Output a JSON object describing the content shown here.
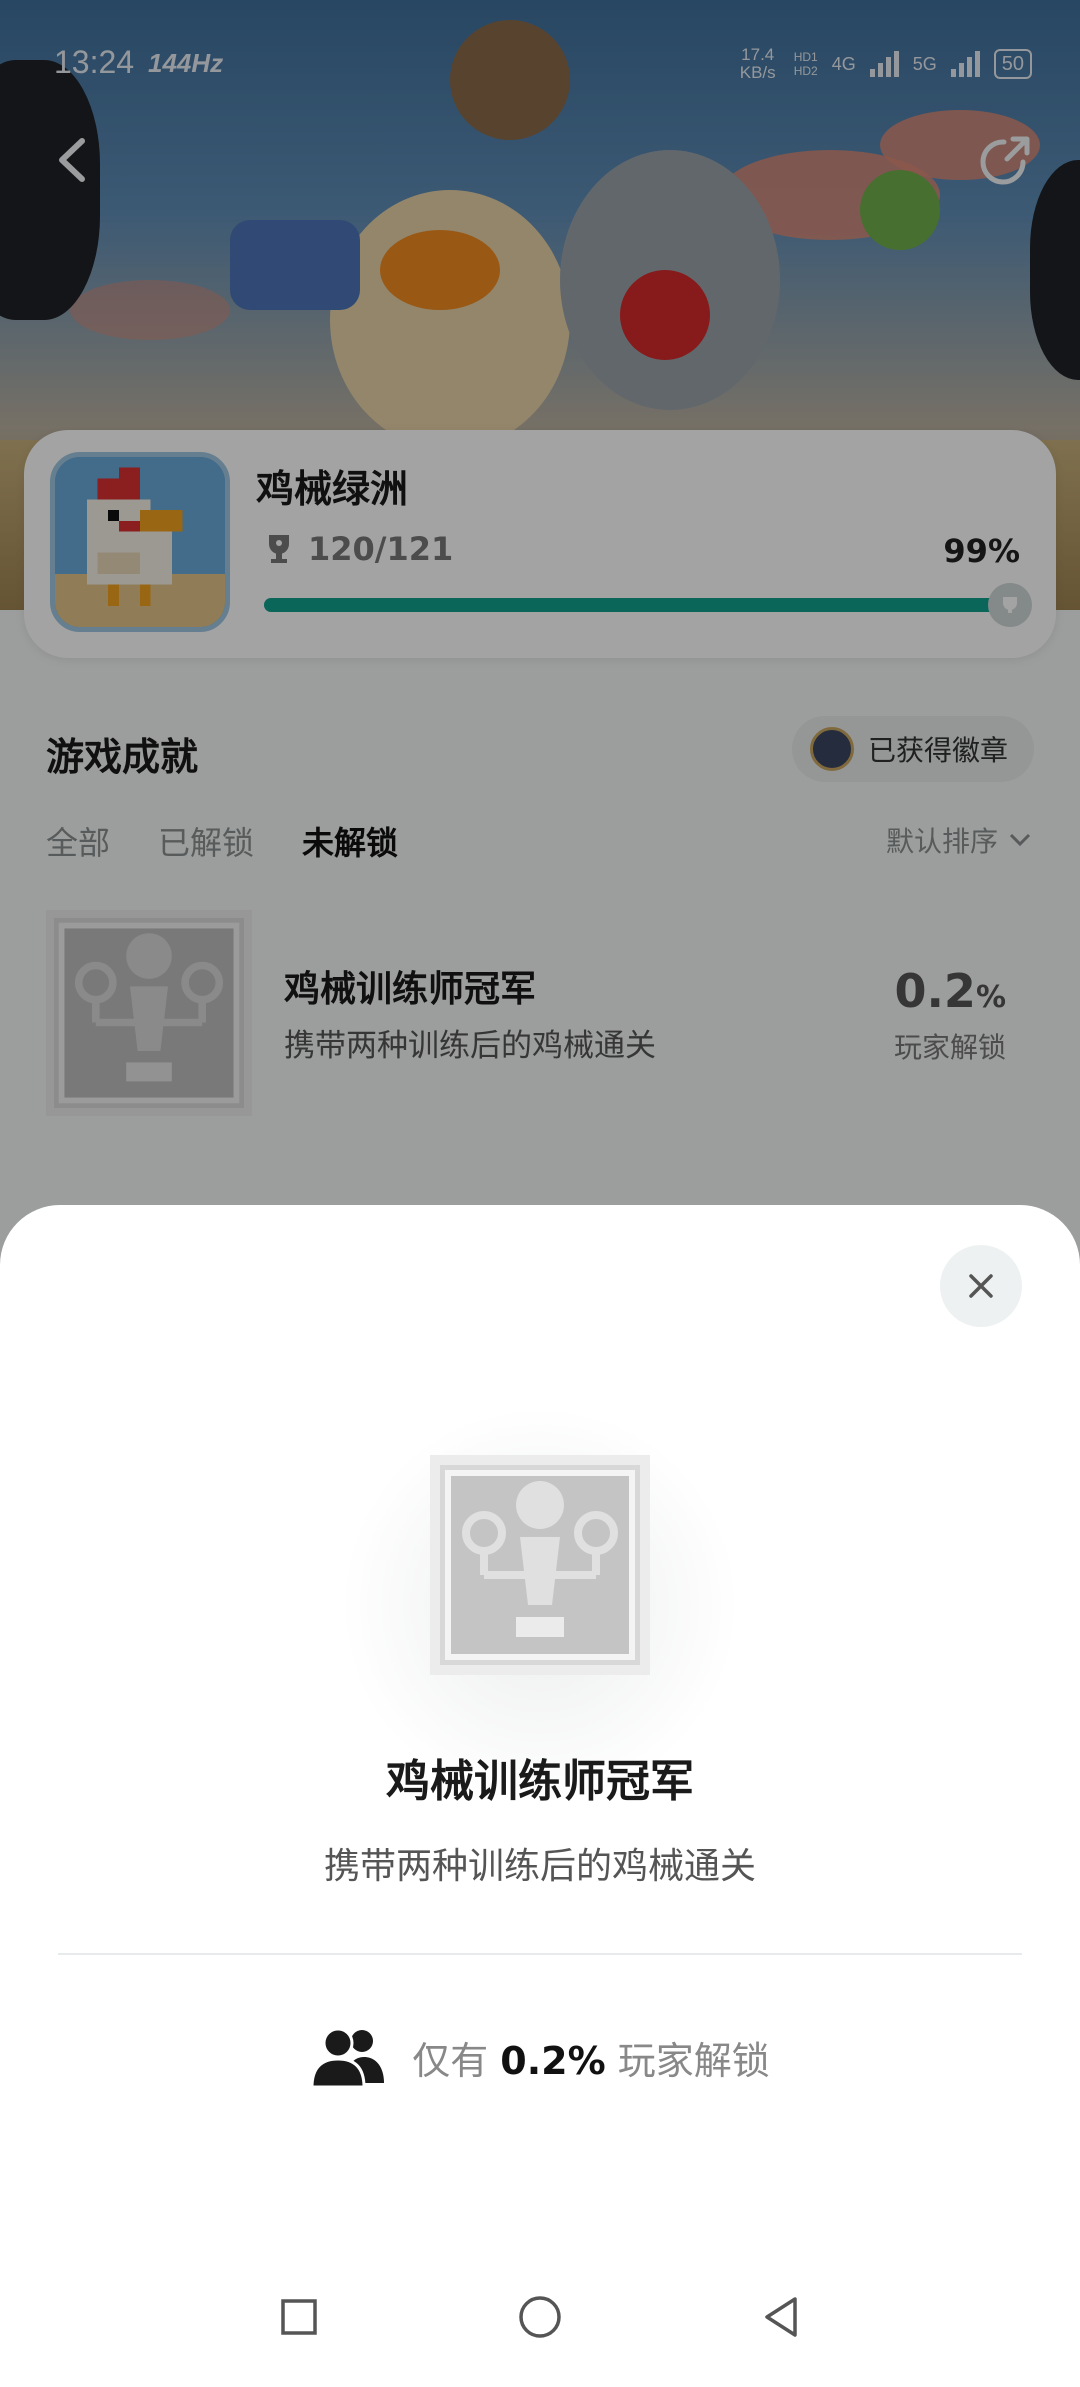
{
  "status_bar": {
    "time": "13:24",
    "refresh_rate": "144Hz",
    "net_speed": "17.4 KB/s",
    "sim1": "HD1",
    "sim2": "HD2",
    "net1": "4G",
    "net2": "5G",
    "battery": "50"
  },
  "header": {
    "back_icon": "chevron-left-icon",
    "share_icon": "share-arrow-icon"
  },
  "game": {
    "title": "鸡械绿洲",
    "trophy_progress": "120/121",
    "percent_text": "99%",
    "progress_fraction": 0.99
  },
  "achievements": {
    "section_title": "游戏成就",
    "badge_button": "已获得徽章",
    "tabs": [
      {
        "label": "全部",
        "active": false
      },
      {
        "label": "已解锁",
        "active": false
      },
      {
        "label": "未解锁",
        "active": true
      }
    ],
    "sort_label": "默认排序",
    "items": [
      {
        "name": "鸡械训练师冠军",
        "description": "携带两种训练后的鸡械通关",
        "percent_value": "0.2",
        "percent_unit": "%",
        "percent_label": "玩家解锁"
      }
    ]
  },
  "sheet": {
    "name": "鸡械训练师冠军",
    "description": "携带两种训练后的鸡械通关",
    "unlock_prefix": "仅有",
    "unlock_value": "0.2%",
    "unlock_suffix": "玩家解锁"
  },
  "colors": {
    "accent": "#10a08c",
    "card_bg": "#ffffff",
    "dim_overlay": "rgba(0,0,0,0.36)"
  }
}
